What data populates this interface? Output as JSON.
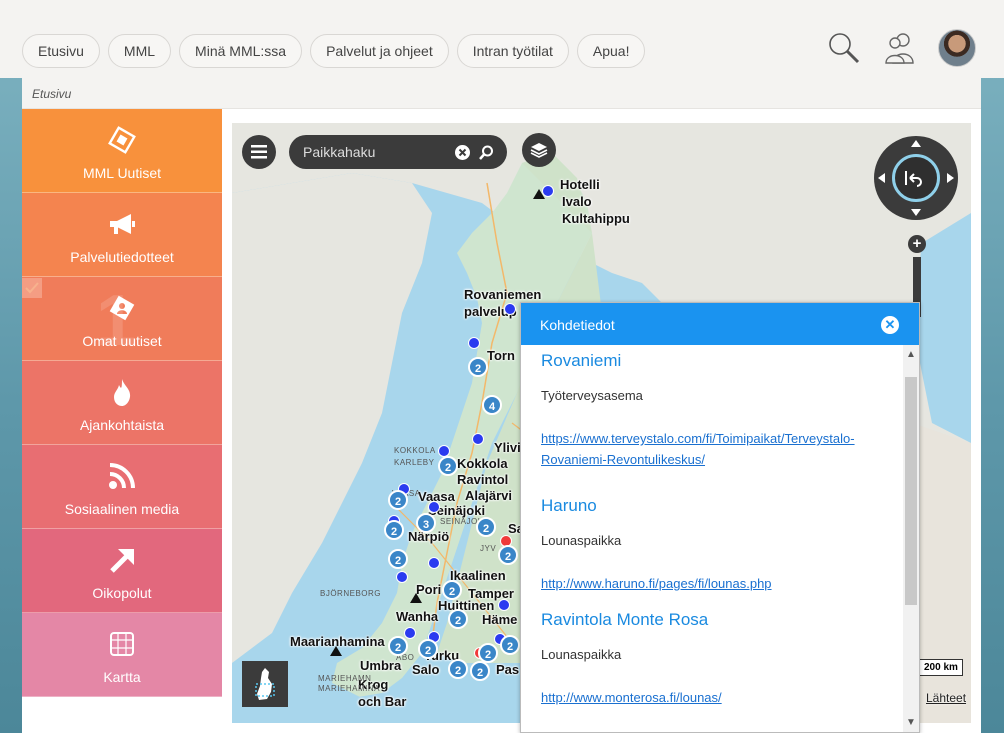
{
  "nav": {
    "items": [
      "Etusivu",
      "MML",
      "Minä MML:ssa",
      "Palvelut ja ohjeet",
      "Intran työtilat",
      "Apua!"
    ]
  },
  "header_icons": [
    "search-icon",
    "users-icon",
    "avatar"
  ],
  "breadcrumb": "Etusivu",
  "sidebar": {
    "items": [
      {
        "label": "MML Uutiset",
        "icon": "news-diamond-icon"
      },
      {
        "label": "Palvelutiedotteet",
        "icon": "megaphone-icon"
      },
      {
        "label": "Omat uutiset",
        "icon": "personal-news-icon"
      },
      {
        "label": "Ajankohtaista",
        "icon": "flame-icon"
      },
      {
        "label": "Sosiaalinen media",
        "icon": "rss-icon"
      },
      {
        "label": "Oikopolut",
        "icon": "arrow-icon"
      },
      {
        "label": "Kartta",
        "icon": "grid-map-icon"
      }
    ],
    "badge_number": "1"
  },
  "map": {
    "search_placeholder": "Paikkahaku",
    "scale": "200 km",
    "sources_label": "Lähteet",
    "place_labels": [
      "Hotelli",
      "Ivalo",
      "Kultahippu",
      "Rovaniemen",
      "palvelup",
      "Torn",
      "Ylivi",
      "Kokkola",
      "Ravintol",
      "Alajärvi",
      "Vaasa",
      "Seinäjoki",
      "Närpiö",
      "Ikaalinen",
      "Pori",
      "Tamper",
      "Huittinen",
      "Wanha",
      "Häme",
      "Maarianhamina",
      "Umbra",
      "Turku",
      "Salo",
      "Pas",
      "Krog",
      "och Bar",
      "Sa"
    ],
    "small_labels": [
      "KOKKOLA",
      "KARLEBY",
      "VAASA",
      "SEINÄJOKI",
      "BJÖRNEBORG",
      "ÅBO",
      "MARIEHAMN",
      "MARIEHAMINA",
      "JYV"
    ],
    "clusters": [
      "2",
      "4",
      "2",
      "2",
      "2",
      "3",
      "2",
      "2",
      "2",
      "2",
      "2",
      "2",
      "2",
      "2",
      "2",
      "2",
      "2"
    ]
  },
  "popup": {
    "title": "Kohdetiedot",
    "items": [
      {
        "name": "Rovaniemi",
        "type": "Työterveysasema",
        "link": "https://www.terveystalo.com/fi/Toimipaikat/Terveystalo-Rovaniemi-Revontulikeskus/"
      },
      {
        "name": "Haruno",
        "type": "Lounaspaikka",
        "link": "http://www.haruno.fi/pages/fi/lounas.php"
      },
      {
        "name": "Ravintola Monte Rosa",
        "type": "Lounaspaikka",
        "link": "http://www.monterosa.fi/lounas/"
      }
    ]
  },
  "colors": {
    "popup_header": "#1a93f0",
    "link": "#1a70d0",
    "poi_name": "#1a8ae0",
    "map_marker": "#2b3bf0",
    "map_cluster": "#3a86c8",
    "sidebar_top": "#f8913c",
    "sidebar_bottom": "#e487a6"
  }
}
